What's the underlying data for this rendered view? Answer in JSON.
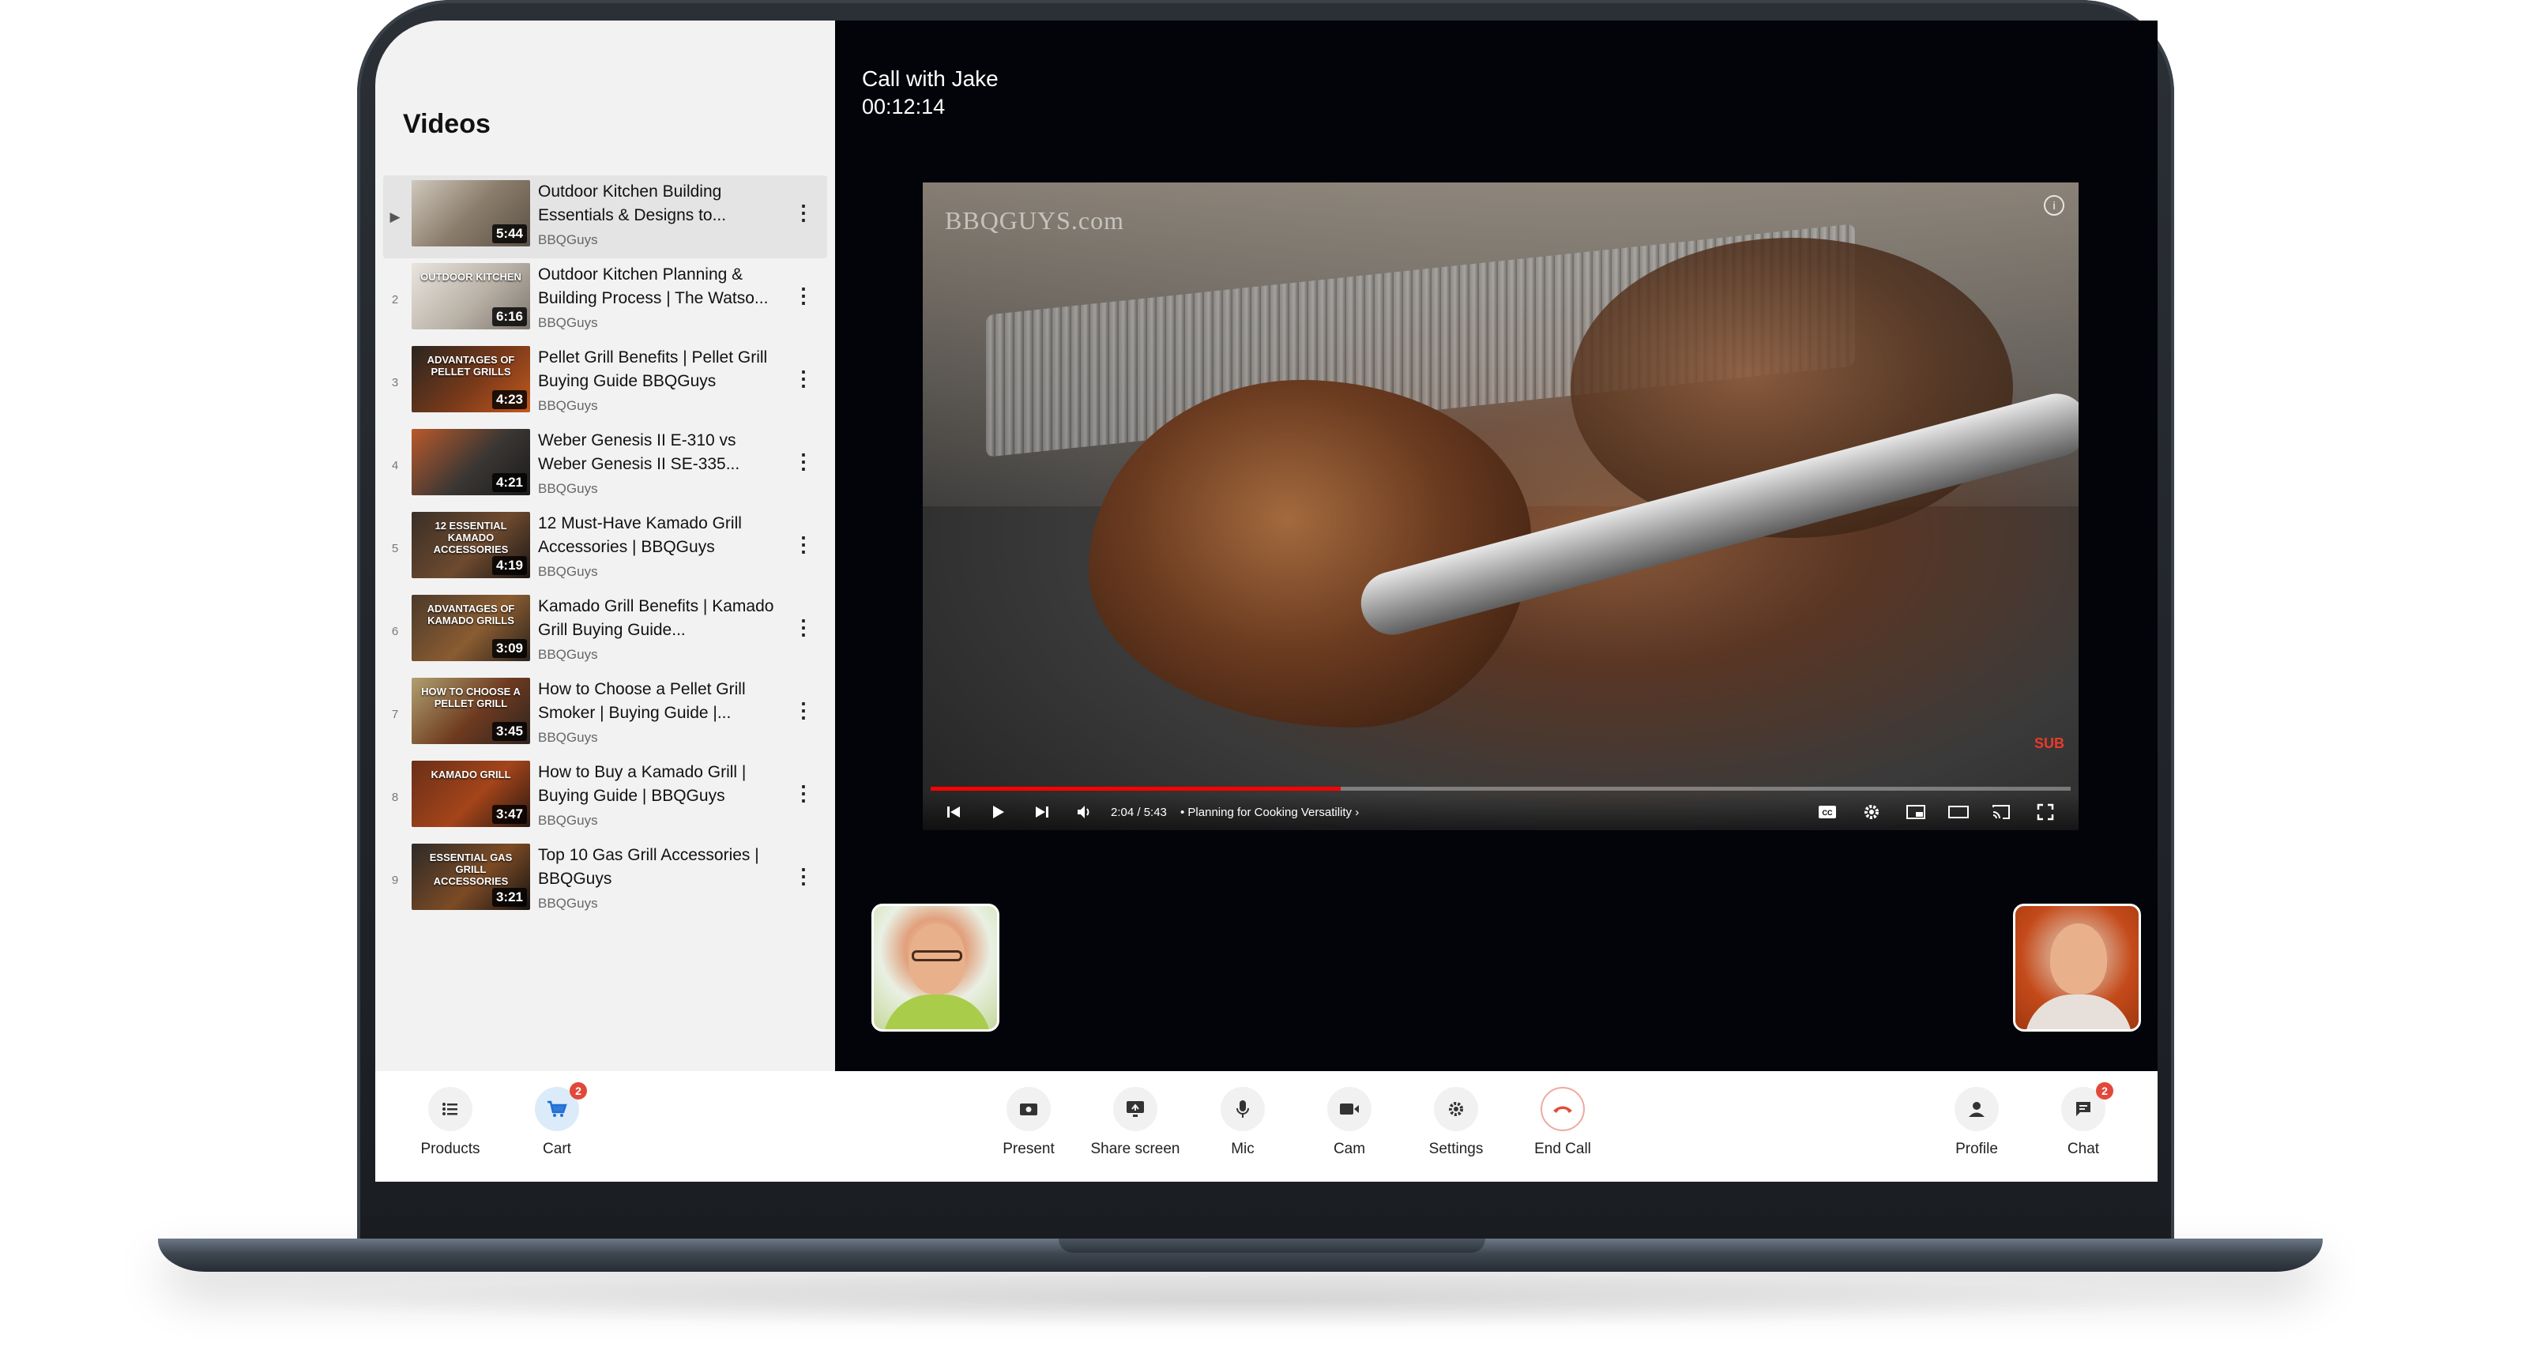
{
  "sidebar": {
    "title": "Videos",
    "items": [
      {
        "index": "▶",
        "title": "Outdoor Kitchen Building Essentials & Designs to...",
        "channel": "BBQGuys",
        "duration": "5:44",
        "overlay": ""
      },
      {
        "index": "2",
        "title": "Outdoor Kitchen Planning & Building Process | The Watso...",
        "channel": "BBQGuys",
        "duration": "6:16",
        "overlay": "OUTDOOR KITCHEN"
      },
      {
        "index": "3",
        "title": "Pellet Grill Benefits | Pellet Grill Buying Guide BBQGuys",
        "channel": "BBQGuys",
        "duration": "4:23",
        "overlay": "ADVANTAGES OF PELLET GRILLS"
      },
      {
        "index": "4",
        "title": "Weber Genesis II E-310 vs Weber Genesis II SE-335...",
        "channel": "BBQGuys",
        "duration": "4:21",
        "overlay": ""
      },
      {
        "index": "5",
        "title": "12 Must-Have Kamado Grill Accessories | BBQGuys",
        "channel": "BBQGuys",
        "duration": "4:19",
        "overlay": "12 ESSENTIAL KAMADO ACCESSORIES"
      },
      {
        "index": "6",
        "title": "Kamado Grill Benefits | Kamado Grill Buying Guide...",
        "channel": "BBQGuys",
        "duration": "3:09",
        "overlay": "ADVANTAGES OF KAMADO GRILLS"
      },
      {
        "index": "7",
        "title": "How to Choose a Pellet Grill Smoker | Buying Guide |...",
        "channel": "BBQGuys",
        "duration": "3:45",
        "overlay": "HOW TO CHOOSE A PELLET GRILL"
      },
      {
        "index": "8",
        "title": "How to Buy a Kamado Grill | Buying Guide | BBQGuys",
        "channel": "BBQGuys",
        "duration": "3:47",
        "overlay": "KAMADO GRILL"
      },
      {
        "index": "9",
        "title": "Top 10 Gas Grill Accessories | BBQGuys",
        "channel": "BBQGuys",
        "duration": "3:21",
        "overlay": "ESSENTIAL GAS GRILL ACCESSORIES"
      }
    ]
  },
  "call": {
    "title": "Call with Jake",
    "timer": "00:12:14"
  },
  "player": {
    "watermark": "BBQGUYS.com",
    "time": "2:04 / 5:43",
    "chapter": "• Planning for Cooking Versatility ›",
    "progress": 0.36,
    "sub_label": "SUB",
    "info_label": "i"
  },
  "toolbar": {
    "products": "Products",
    "cart": "Cart",
    "cart_badge": "2",
    "present": "Present",
    "share_screen": "Share screen",
    "mic": "Mic",
    "cam": "Cam",
    "settings": "Settings",
    "end_call": "End Call",
    "profile": "Profile",
    "chat": "Chat",
    "chat_badge": "2"
  },
  "colors": {
    "accent": "#1f6fd6",
    "danger": "#e14b3b",
    "badge": "#e2483a",
    "progress": "#ff0000"
  }
}
